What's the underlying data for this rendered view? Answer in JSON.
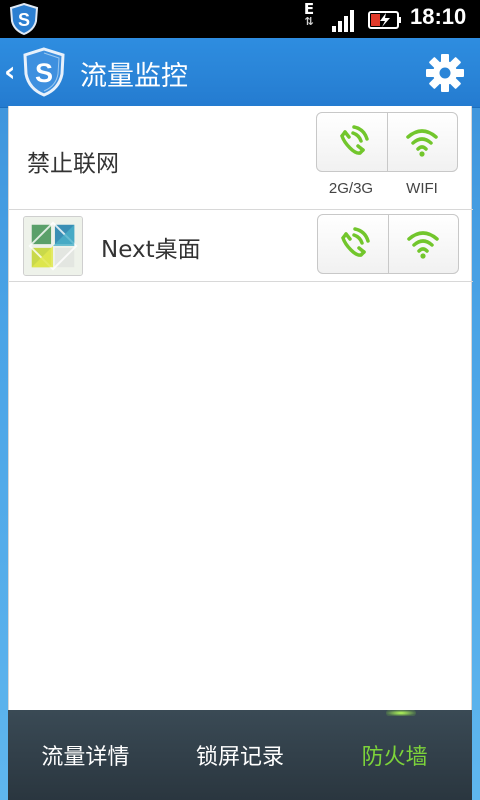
{
  "status_bar": {
    "network_type": "E",
    "network_arrows": "⇅",
    "time": "18:10"
  },
  "header": {
    "back_glyph": "‹",
    "title": "流量监控",
    "settings_icon": "gear-icon"
  },
  "firewall": {
    "disable_row": {
      "label": "禁止联网",
      "col_mobile_label": "2G/3G",
      "col_wifi_label": "WIFI"
    },
    "apps": [
      {
        "name": "Next桌面",
        "mobile_enabled": true,
        "wifi_enabled": true
      }
    ]
  },
  "bottom_nav": {
    "items": [
      {
        "label": "流量详情",
        "active": false
      },
      {
        "label": "锁屏记录",
        "active": false
      },
      {
        "label": "防火墙",
        "active": true
      }
    ]
  },
  "colors": {
    "accent_green": "#7dd43a",
    "header_blue": "#2a85d8"
  }
}
